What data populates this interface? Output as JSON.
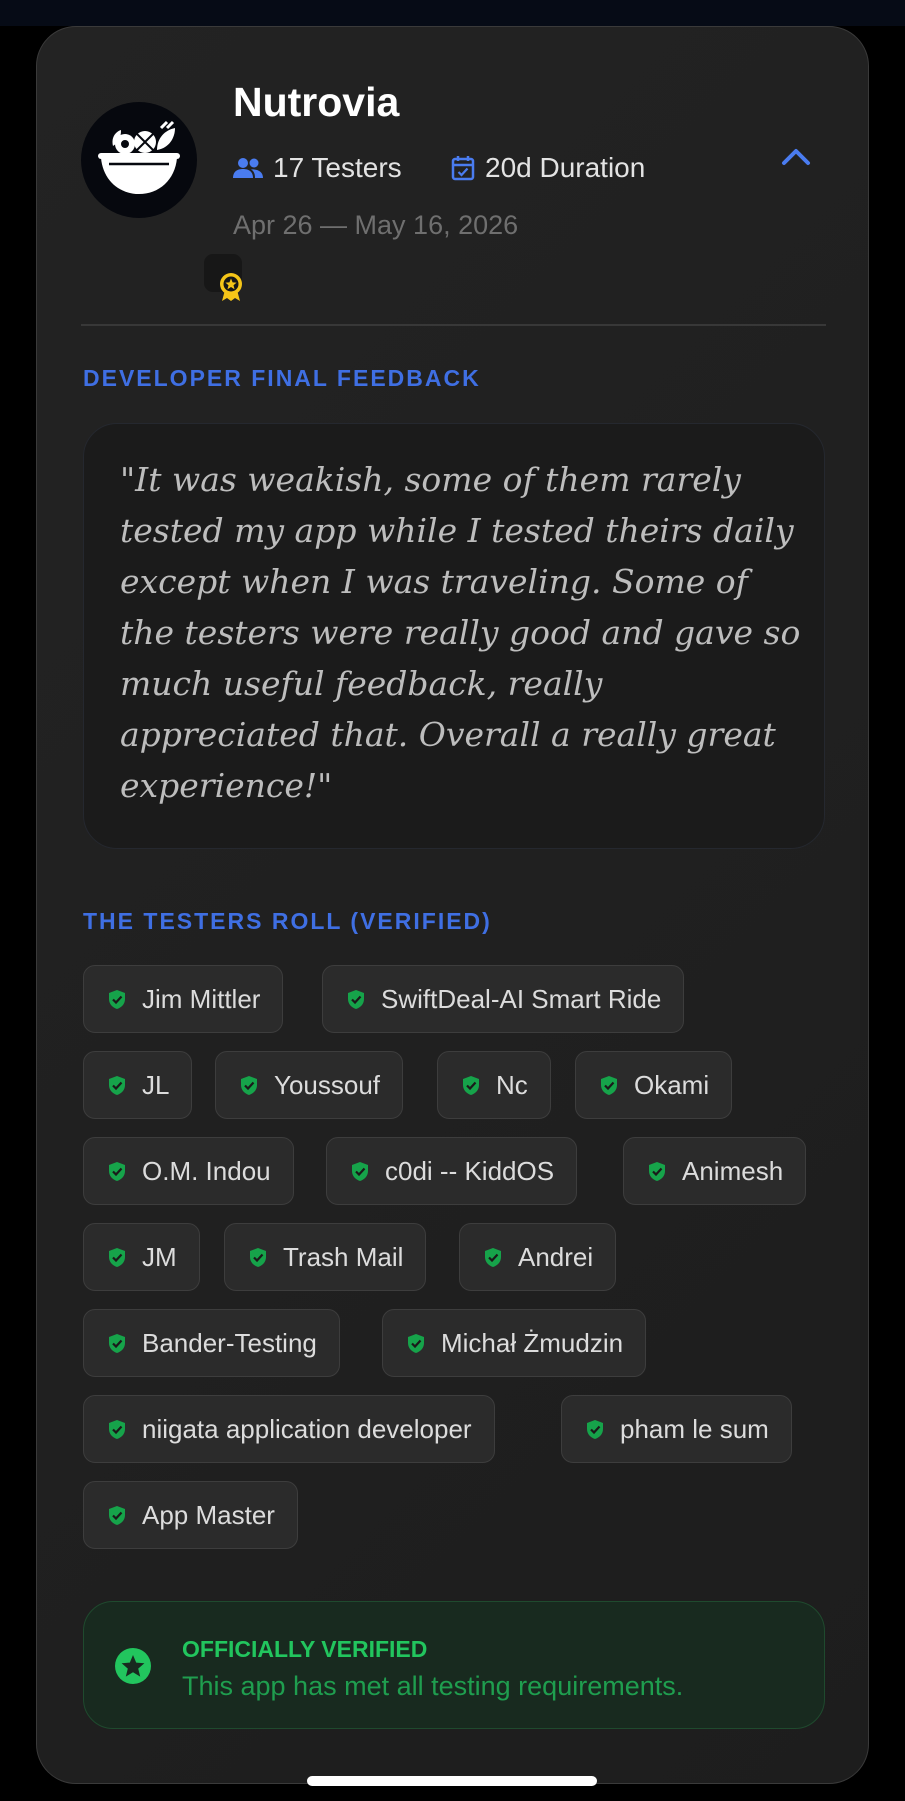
{
  "app": {
    "name": "Nutrovia",
    "testers": "17 Testers",
    "duration": "20d Duration",
    "dates": "Apr 26 — May 16, 2026"
  },
  "feedback": {
    "section_title": "DEVELOPER FINAL FEEDBACK",
    "quote": "\"It was weakish, some of them rarely tested my app while I tested theirs daily except when I was traveling. Some of the testers were really good and gave so much useful feedback, really appreciated that. Overall a really great experience!\""
  },
  "testers_roll": {
    "section_title": "THE TESTERS ROLL (VERIFIED)",
    "testers": [
      "Jim Mittler",
      "SwiftDeal-AI Smart Ride",
      "JL",
      "Youssouf",
      "Nc",
      "Okami",
      "O.M. Indou",
      "c0di -- KiddOS",
      "Animesh",
      "JM",
      "Trash Mail",
      "Andrei",
      "Bander-Testing",
      "Michał Żmudzin",
      "niigata application developer",
      "pham le sum",
      "App Master"
    ]
  },
  "verification": {
    "title": "OFFICIALLY VERIFIED",
    "description": "This app has met all testing requirements."
  },
  "colors": {
    "accent_blue": "#3f6fe3",
    "verified_green": "#22c55e",
    "badge_gold": "#f5c518"
  },
  "icons": {
    "testers": "people-icon",
    "duration": "calendar-check-icon",
    "collapse": "chevron-up-icon",
    "tester_chip": "shield-check-icon",
    "verified": "star-badge-icon"
  }
}
